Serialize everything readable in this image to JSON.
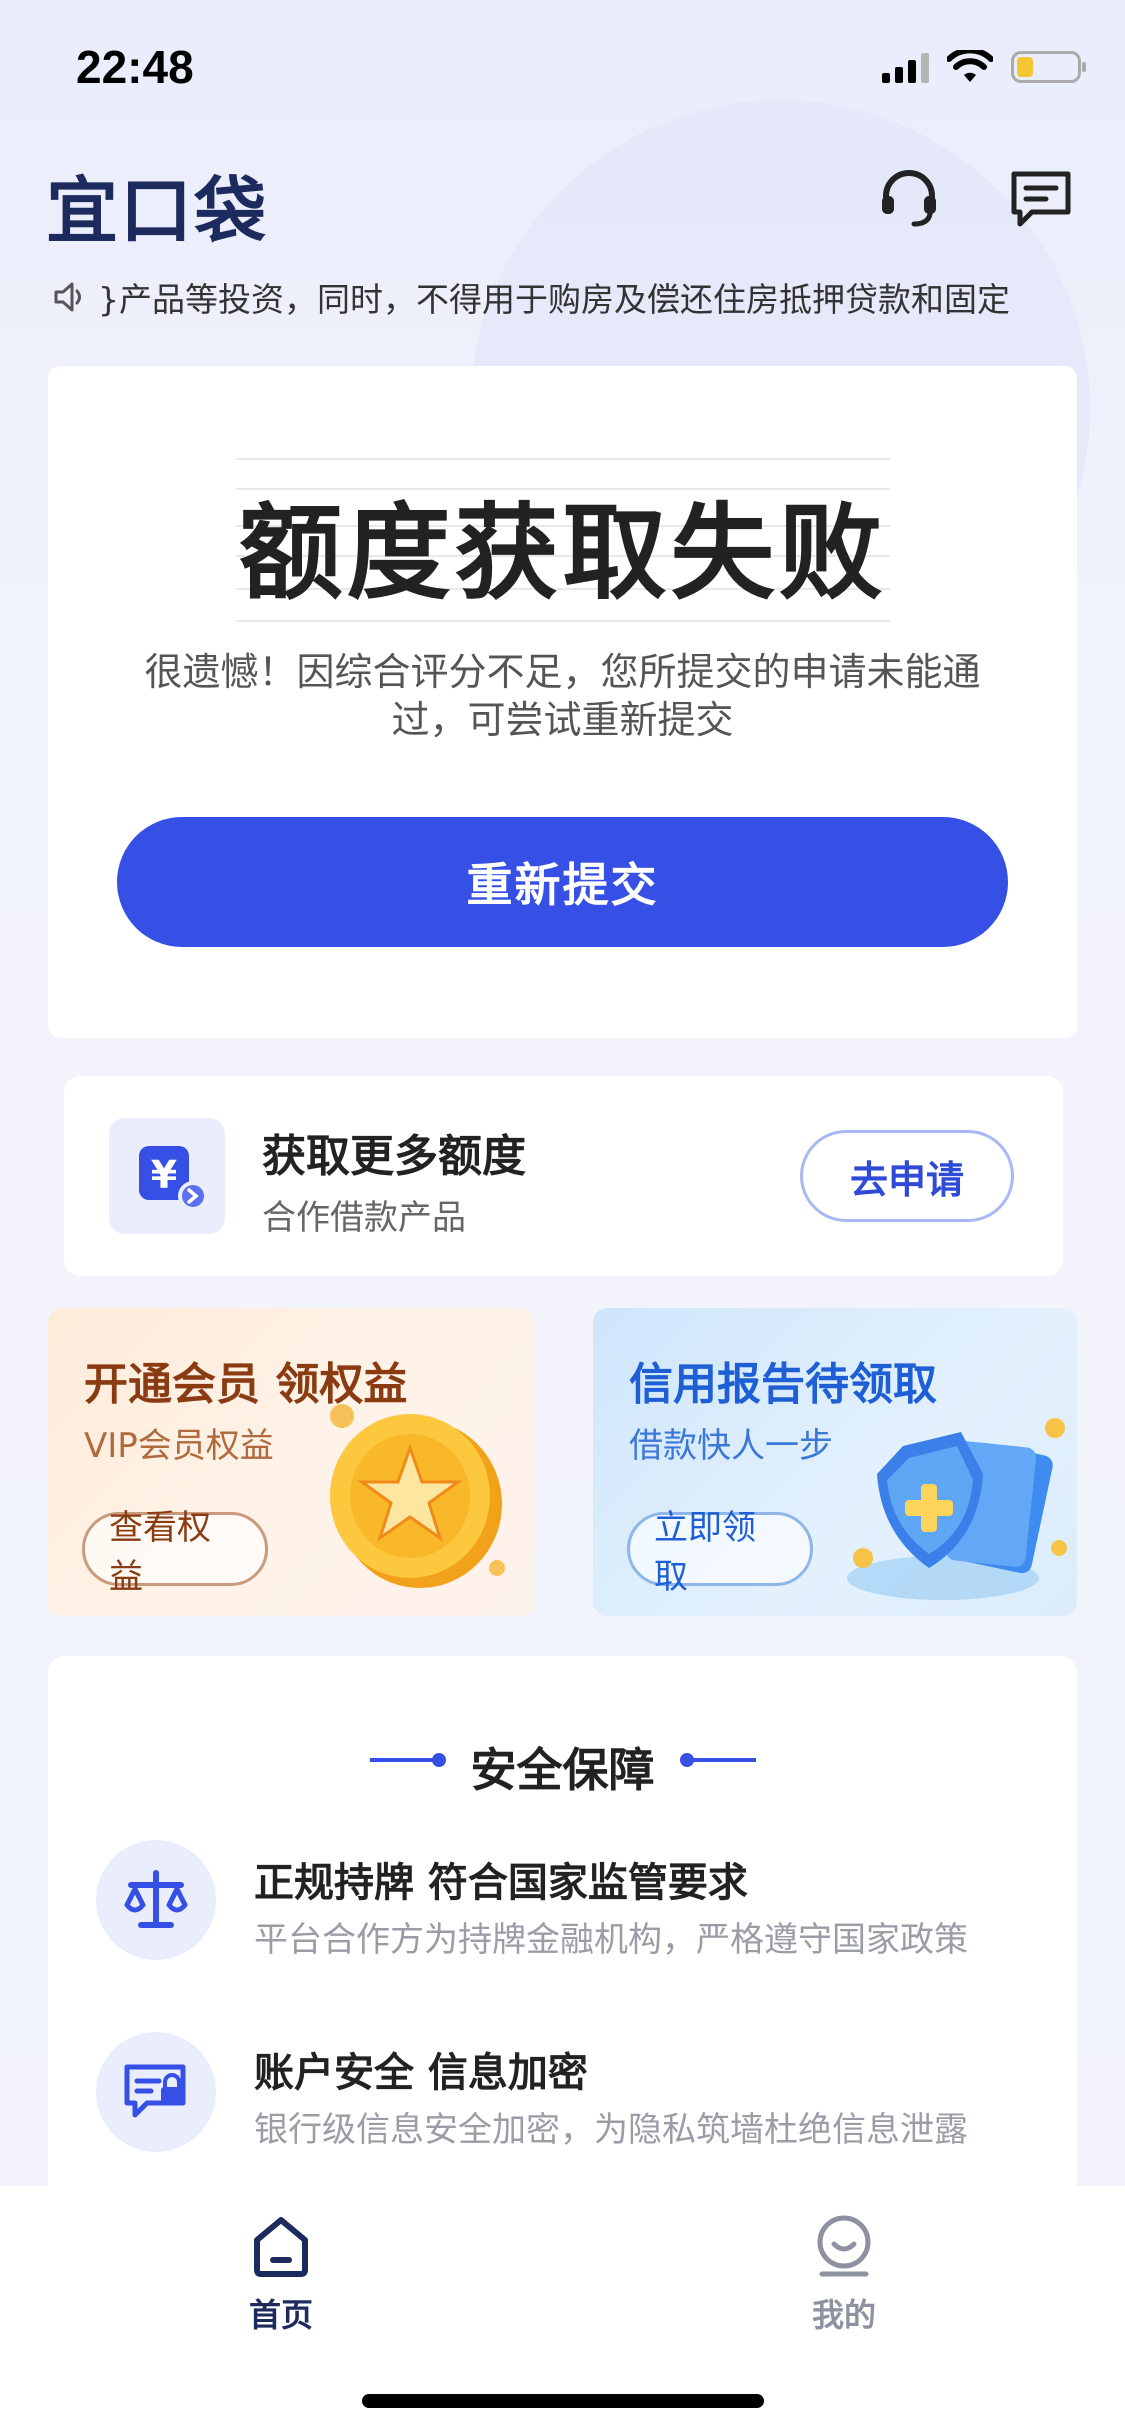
{
  "status_bar": {
    "time": "22:48"
  },
  "header": {
    "logo": "宜口袋",
    "icons": [
      "headset-icon",
      "message-icon"
    ]
  },
  "notice": {
    "icon": "speaker-icon",
    "text": "}产品等投资，同时，不得用于购房及偿还住房抵押贷款和固定"
  },
  "result": {
    "title": "额度获取失败",
    "description": "很遗憾！因综合评分不足，您所提交的申请未能通过，可尝试重新提交",
    "button_label": "重新提交"
  },
  "more_quota": {
    "title": "获取更多额度",
    "subtitle": "合作借款产品",
    "button_label": "去申请",
    "icon": "yen-icon"
  },
  "promos": [
    {
      "title": "开通会员 领权益",
      "subtitle": "VIP会员权益",
      "button_label": "查看权益",
      "icon": "star-coin-icon"
    },
    {
      "title": "信用报告待领取",
      "subtitle": "借款快人一步",
      "button_label": "立即领取",
      "icon": "shield-icon"
    }
  ],
  "security": {
    "heading": "安全保障",
    "items": [
      {
        "title": "正规持牌 符合国家监管要求",
        "subtitle": "平台合作方为持牌金融机构，严格遵守国家政策",
        "icon": "scale-icon"
      },
      {
        "title": "账户安全 信息加密",
        "subtitle": "银行级信息安全加密，为隐私筑墙杜绝信息泄露",
        "icon": "lock-message-icon"
      }
    ]
  },
  "tab_bar": {
    "tabs": [
      {
        "label": "首页",
        "icon": "home-icon",
        "active": true
      },
      {
        "label": "我的",
        "icon": "profile-icon",
        "active": false
      }
    ]
  },
  "colors": {
    "primary": "#3650e6",
    "logo": "#1c2a5e",
    "vip_title": "#8a3b12",
    "credit_title": "#1f5fd6"
  }
}
